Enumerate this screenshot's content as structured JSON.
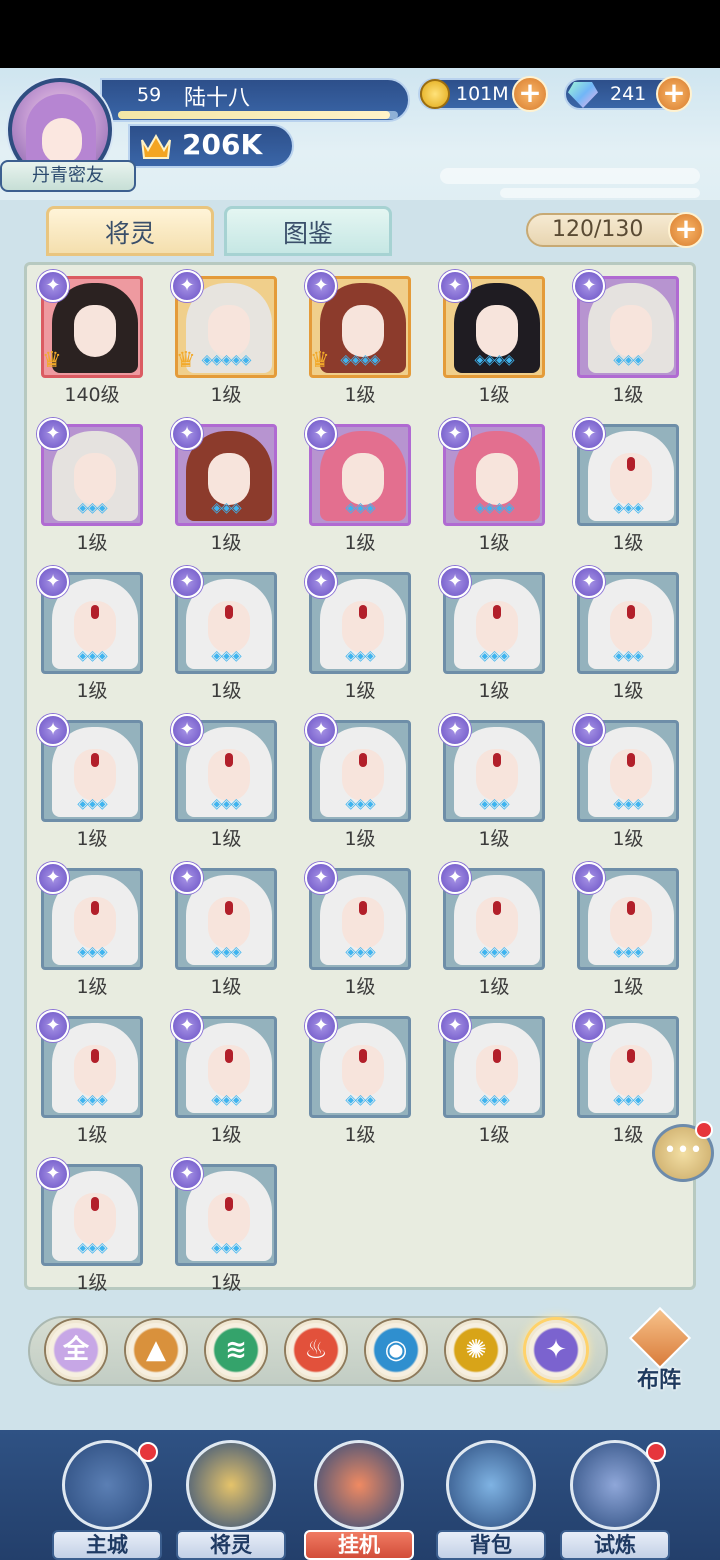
{
  "header": {
    "level": "59",
    "player_name": "陆十八",
    "title_badge": "丹青密友",
    "power": "206K",
    "exp_fraction": 0.97
  },
  "currencies": {
    "gold": "101M",
    "gems": "241"
  },
  "tabs": [
    {
      "label": "将灵",
      "active": true
    },
    {
      "label": "图鉴",
      "active": false
    }
  ],
  "capacity": "120/130",
  "heroes": [
    {
      "level": "140级",
      "frame": "red",
      "crown": true,
      "stars": 0,
      "hair": "#2b2221"
    },
    {
      "level": "1级",
      "frame": "gold",
      "crown": true,
      "stars": 5,
      "hair": "#e7e4df"
    },
    {
      "level": "1级",
      "frame": "gold",
      "crown": true,
      "stars": 4,
      "hair": "#8c3b2c"
    },
    {
      "level": "1级",
      "frame": "gold",
      "crown": false,
      "stars": 4,
      "hair": "#1f1c22"
    },
    {
      "level": "1级",
      "frame": "purple",
      "crown": false,
      "stars": 3,
      "hair": "#e5e2df"
    },
    {
      "level": "1级",
      "frame": "purple",
      "crown": false,
      "stars": 3,
      "hair": "#e5e2df"
    },
    {
      "level": "1级",
      "frame": "purple",
      "crown": false,
      "stars": 3,
      "hair": "#8c3b2c"
    },
    {
      "level": "1级",
      "frame": "purple",
      "crown": false,
      "stars": 3,
      "hair": "#e36f8f"
    },
    {
      "level": "1级",
      "frame": "purple",
      "crown": false,
      "stars": 4,
      "hair": "#e36f8f"
    },
    {
      "level": "1级",
      "frame": "blue",
      "crown": false,
      "stars": 3,
      "hair": "#eeeeee"
    },
    {
      "level": "1级",
      "frame": "blue",
      "crown": false,
      "stars": 3,
      "hair": "#eeeeee"
    },
    {
      "level": "1级",
      "frame": "blue",
      "crown": false,
      "stars": 3,
      "hair": "#eeeeee"
    },
    {
      "level": "1级",
      "frame": "blue",
      "crown": false,
      "stars": 3,
      "hair": "#eeeeee"
    },
    {
      "level": "1级",
      "frame": "blue",
      "crown": false,
      "stars": 3,
      "hair": "#eeeeee"
    },
    {
      "level": "1级",
      "frame": "blue",
      "crown": false,
      "stars": 3,
      "hair": "#eeeeee"
    },
    {
      "level": "1级",
      "frame": "blue",
      "crown": false,
      "stars": 3,
      "hair": "#eeeeee"
    },
    {
      "level": "1级",
      "frame": "blue",
      "crown": false,
      "stars": 3,
      "hair": "#eeeeee"
    },
    {
      "level": "1级",
      "frame": "blue",
      "crown": false,
      "stars": 3,
      "hair": "#eeeeee"
    },
    {
      "level": "1级",
      "frame": "blue",
      "crown": false,
      "stars": 3,
      "hair": "#eeeeee"
    },
    {
      "level": "1级",
      "frame": "blue",
      "crown": false,
      "stars": 3,
      "hair": "#eeeeee"
    },
    {
      "level": "1级",
      "frame": "blue",
      "crown": false,
      "stars": 3,
      "hair": "#eeeeee"
    },
    {
      "level": "1级",
      "frame": "blue",
      "crown": false,
      "stars": 3,
      "hair": "#eeeeee"
    },
    {
      "level": "1级",
      "frame": "blue",
      "crown": false,
      "stars": 3,
      "hair": "#eeeeee"
    },
    {
      "level": "1级",
      "frame": "blue",
      "crown": false,
      "stars": 3,
      "hair": "#eeeeee"
    },
    {
      "level": "1级",
      "frame": "blue",
      "crown": false,
      "stars": 3,
      "hair": "#eeeeee"
    },
    {
      "level": "1级",
      "frame": "blue",
      "crown": false,
      "stars": 3,
      "hair": "#eeeeee"
    },
    {
      "level": "1级",
      "frame": "blue",
      "crown": false,
      "stars": 3,
      "hair": "#eeeeee"
    },
    {
      "level": "1级",
      "frame": "blue",
      "crown": false,
      "stars": 3,
      "hair": "#eeeeee"
    },
    {
      "level": "1级",
      "frame": "blue",
      "crown": false,
      "stars": 3,
      "hair": "#eeeeee"
    },
    {
      "level": "1级",
      "frame": "blue",
      "crown": false,
      "stars": 3,
      "hair": "#eeeeee"
    },
    {
      "level": "1级",
      "frame": "blue",
      "crown": false,
      "stars": 3,
      "hair": "#eeeeee"
    },
    {
      "level": "1级",
      "frame": "blue",
      "crown": false,
      "stars": 3,
      "hair": "#eeeeee"
    }
  ],
  "filters": [
    {
      "icon": "all-icon",
      "glyph": "全",
      "color": "#c7a7e6",
      "selected": false
    },
    {
      "icon": "mountain-icon",
      "glyph": "▲",
      "color": "#d9913c",
      "selected": false
    },
    {
      "icon": "wind-icon",
      "glyph": "≋",
      "color": "#34a36b",
      "selected": false
    },
    {
      "icon": "fire-icon",
      "glyph": "♨",
      "color": "#e2513b",
      "selected": false
    },
    {
      "icon": "water-icon",
      "glyph": "◉",
      "color": "#2f8fcf",
      "selected": false
    },
    {
      "icon": "light-icon",
      "glyph": "✺",
      "color": "#d8a418",
      "selected": false
    },
    {
      "icon": "shadow-icon",
      "glyph": "✦",
      "color": "#7b63cf",
      "selected": true
    }
  ],
  "formation_label": "布阵",
  "nav": [
    {
      "label": "主城",
      "icon": "castle-icon",
      "badge": true,
      "active": false
    },
    {
      "label": "将灵",
      "icon": "helmet-icon",
      "badge": false,
      "active": false
    },
    {
      "label": "挂机",
      "icon": "swords-icon",
      "badge": false,
      "active": true
    },
    {
      "label": "背包",
      "icon": "bag-icon",
      "badge": false,
      "active": false
    },
    {
      "label": "试炼",
      "icon": "banner-icon",
      "badge": true,
      "active": false
    }
  ]
}
